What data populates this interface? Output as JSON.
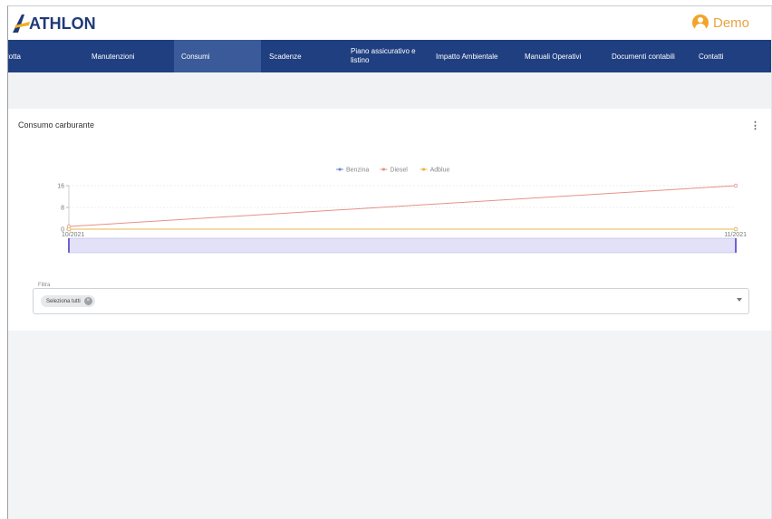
{
  "header": {
    "logo_text": "ATHLON",
    "user_name": "Demo"
  },
  "nav": [
    {
      "label": "Flotta",
      "active": false
    },
    {
      "label": "Manutenzioni",
      "active": false
    },
    {
      "label": "Consumi",
      "active": true
    },
    {
      "label": "Scadenze",
      "active": false
    },
    {
      "label": "Piano assicurativo e listino",
      "active": false
    },
    {
      "label": "Impatto Ambientale",
      "active": false
    },
    {
      "label": "Manuali Operativi",
      "active": false
    },
    {
      "label": "Documenti contabili",
      "active": false
    },
    {
      "label": "Contatti",
      "active": false
    }
  ],
  "card": {
    "title": "Consumo carburante",
    "menu_icon": "kebab-icon"
  },
  "chart_data": {
    "type": "line",
    "title": "",
    "x": [
      "10/2021",
      "11/2021"
    ],
    "series": [
      {
        "name": "Benzina",
        "values": [
          0,
          0
        ],
        "color": "#6f8fd6"
      },
      {
        "name": "Diesel",
        "values": [
          1,
          16
        ],
        "color": "#e8908a"
      },
      {
        "name": "Adblue",
        "values": [
          0,
          0
        ],
        "color": "#e8b64a"
      }
    ],
    "ylim": [
      0,
      16
    ],
    "yticks": [
      "0",
      "8",
      "16"
    ],
    "legend": "top-center",
    "grid": true
  },
  "filter": {
    "label": "Filtra",
    "chip_label": "Seleziona tutti",
    "chip_icon": "clear-icon",
    "dropdown_icon": "chevron-down-icon"
  },
  "colors": {
    "nav_bg": "#1f3f80",
    "nav_active": "#3a5a99",
    "accent": "#f2a42a"
  }
}
